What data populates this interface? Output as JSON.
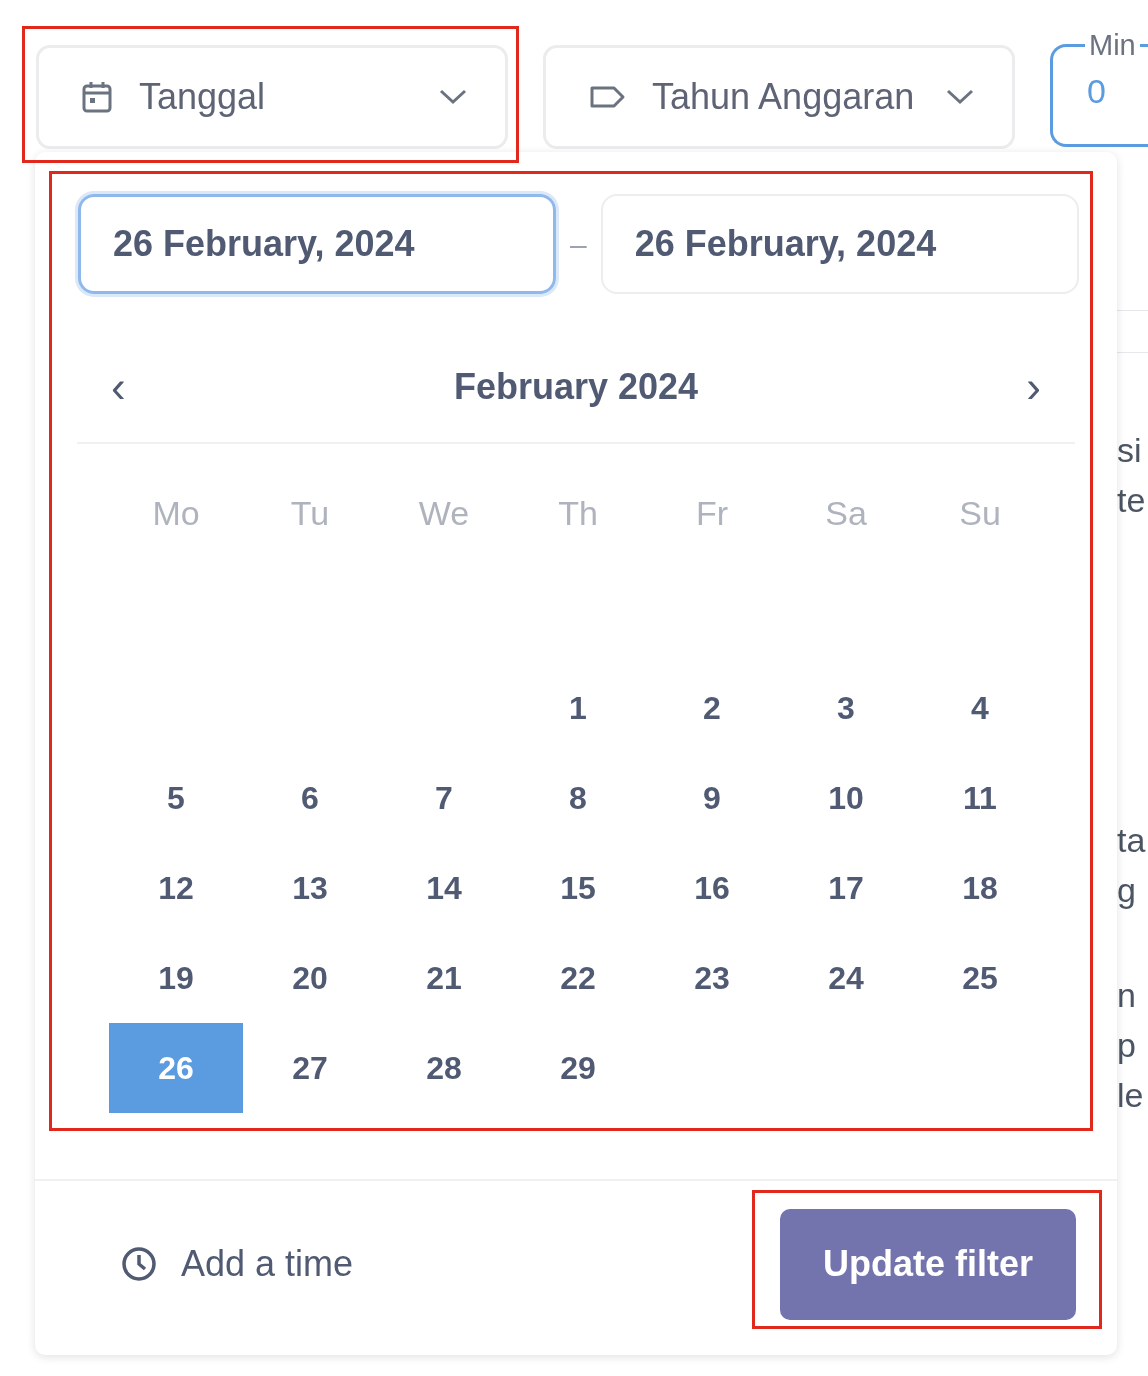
{
  "filters": [
    {
      "kind": "calendar",
      "label": "Tanggal"
    },
    {
      "kind": "tag",
      "label": "Tahun Anggaran"
    }
  ],
  "min_field": {
    "label": "Min",
    "value": "0"
  },
  "background_text": [
    "si",
    "te",
    "ta",
    "g",
    "n",
    "p",
    "le"
  ],
  "date_picker": {
    "start_date": {
      "value": "26 February, 2024",
      "focused": true
    },
    "end_date": {
      "value": "26 February, 2024",
      "focused": false
    },
    "separator": "–",
    "month": "February 2024",
    "prev": "‹",
    "next": "›",
    "weekdays": [
      "Mo",
      "Tu",
      "We",
      "Th",
      "Fr",
      "Sa",
      "Su"
    ],
    "weeks": [
      [
        {
          "label": "1",
          "selected": false
        },
        {
          "label": "2",
          "selected": false
        },
        {
          "label": "3",
          "selected": false
        },
        {
          "label": "4",
          "selected": false
        }
      ],
      [
        {
          "label": "5",
          "selected": false
        },
        {
          "label": "6",
          "selected": false
        },
        {
          "label": "7",
          "selected": false
        },
        {
          "label": "8",
          "selected": false
        },
        {
          "label": "9",
          "selected": false
        },
        {
          "label": "10",
          "selected": false
        },
        {
          "label": "11",
          "selected": false
        }
      ],
      [
        {
          "label": "12",
          "selected": false
        },
        {
          "label": "13",
          "selected": false
        },
        {
          "label": "14",
          "selected": false
        },
        {
          "label": "15",
          "selected": false
        },
        {
          "label": "16",
          "selected": false
        },
        {
          "label": "17",
          "selected": false
        },
        {
          "label": "18",
          "selected": false
        }
      ],
      [
        {
          "label": "19",
          "selected": false
        },
        {
          "label": "20",
          "selected": false
        },
        {
          "label": "21",
          "selected": false
        },
        {
          "label": "22",
          "selected": false
        },
        {
          "label": "23",
          "selected": false
        },
        {
          "label": "24",
          "selected": false
        },
        {
          "label": "25",
          "selected": false
        }
      ],
      [
        {
          "label": "26",
          "selected": true
        },
        {
          "label": "27",
          "selected": false
        },
        {
          "label": "28",
          "selected": false
        },
        {
          "label": "29",
          "selected": false
        }
      ]
    ],
    "add_time": "Add a time",
    "update_button": "Update filter"
  }
}
